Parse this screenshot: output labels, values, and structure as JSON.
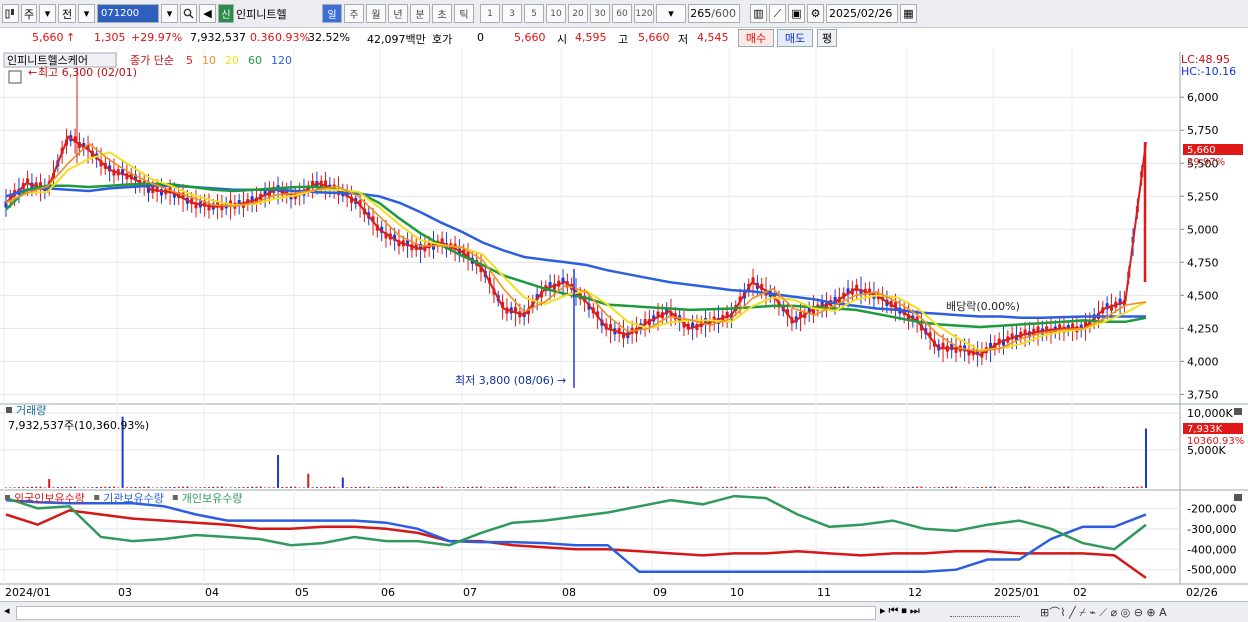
{
  "toolbar": {
    "chart_icon": "chart-icon",
    "period_main": "주",
    "prev_label": "전",
    "stock_code": "071200",
    "badge": "신",
    "stock_name": "인피니트헬",
    "periods": [
      "일",
      "주",
      "월",
      "년",
      "분",
      "초",
      "틱"
    ],
    "active_period": "일",
    "intervals": [
      "1",
      "3",
      "5",
      "10",
      "20",
      "30",
      "60",
      "120"
    ],
    "bar_count": "265",
    "bar_total": "/600",
    "date": "2025/02/26"
  },
  "quote": {
    "price": "5,660",
    "arrow": "↑",
    "change": "1,305",
    "change_pct": "+29.97%",
    "volume": "7,932,537",
    "vol_ratio": "0.36",
    "turnover": "0.93%",
    "ratio2": "32.52%",
    "amount": "42,097백만",
    "hoga_label": "호가",
    "hoga_value": "0",
    "hoga_price": "5,660",
    "open_label": "시",
    "open": "4,595",
    "high_label": "고",
    "high": "5,660",
    "low_label": "저",
    "low": "4,545",
    "buy_label": "매수",
    "sell_label": "매도",
    "avg_label": "평"
  },
  "price_panel": {
    "stock_label": "인피니트헬스케어",
    "ma_prefix": "종가 단순",
    "ma_periods": [
      "5",
      "10",
      "20",
      "60",
      "120"
    ],
    "ma_colors": [
      "#d42020",
      "#f09020",
      "#f0e020",
      "#1d9a3c",
      "#2b5fe0"
    ],
    "high_note": "최고 6,300 (02/01)",
    "low_note": "최저 3,800 (08/06)",
    "dividend_note": "배당락(0.00%)",
    "lc": "LC:48.95",
    "hc": "HC:-10.16",
    "last_price": "5,660",
    "last_pct": "29.97%"
  },
  "volume_panel": {
    "title": "거래량",
    "value": "7,932,537주(10,360.93%)",
    "last_k": "7,933K",
    "last_pct": "10360.93%"
  },
  "holdings_panel": {
    "series": [
      "외국인보유수량",
      "기관보유수량",
      "개인보유수량"
    ],
    "colors": [
      "#d41818",
      "#2b5fe0",
      "#2f9a5c"
    ]
  },
  "date_axis": {
    "labels": [
      "2024/01",
      "03",
      "04",
      "05",
      "06",
      "07",
      "08",
      "09",
      "10",
      "11",
      "12",
      "2025/01",
      "02"
    ],
    "right": "02/26"
  },
  "chart_data": [
    {
      "type": "line",
      "title": "인피니트헬스케어",
      "ylim": [
        3700,
        6350
      ],
      "y_ticks": [
        "6,000",
        "5,750",
        "5,500",
        "5,250",
        "5,000",
        "4,750",
        "4,500",
        "4,250",
        "4,000",
        "3,750"
      ],
      "series": [
        {
          "name": "종가",
          "color": "#d42020",
          "values": [
            5200,
            5350,
            5300,
            5700,
            5600,
            5450,
            5400,
            5300,
            5280,
            5200,
            5170,
            5180,
            5220,
            5300,
            5250,
            5350,
            5300,
            5200,
            5000,
            4900,
            4850,
            4900,
            4830,
            4700,
            4400,
            4350,
            4550,
            4600,
            4450,
            4250,
            4200,
            4300,
            4380,
            4250,
            4300,
            4350,
            4600,
            4500,
            4300,
            4400,
            4450,
            4550,
            4500,
            4400,
            4300,
            4100,
            4100,
            4050,
            4150,
            4200,
            4230,
            4250,
            4250,
            4400,
            4450,
            5660
          ]
        },
        {
          "name": "120",
          "color": "#2b5fe0",
          "values": [
            5250,
            5300,
            5310,
            5300,
            5290,
            5310,
            5320,
            5330,
            5330,
            5320,
            5310,
            5300,
            5300,
            5300,
            5290,
            5280,
            5275,
            5270,
            5250,
            5200,
            5130,
            5050,
            4980,
            4900,
            4840,
            4790,
            4770,
            4750,
            4730,
            4690,
            4660,
            4630,
            4600,
            4580,
            4560,
            4540,
            4530,
            4510,
            4490,
            4470,
            4440,
            4420,
            4400,
            4390,
            4370,
            4360,
            4350,
            4340,
            4340,
            4330,
            4330,
            4335,
            4340,
            4340,
            4340,
            4340
          ]
        },
        {
          "name": "60",
          "color": "#1d9a3c",
          "values": [
            5150,
            5300,
            5330,
            5330,
            5320,
            5330,
            5340,
            5345,
            5340,
            5320,
            5300,
            5290,
            5300,
            5310,
            5320,
            5320,
            5300,
            5280,
            5200,
            5080,
            4970,
            4880,
            4800,
            4730,
            4650,
            4600,
            4550,
            4510,
            4480,
            4430,
            4420,
            4410,
            4400,
            4390,
            4395,
            4400,
            4410,
            4420,
            4420,
            4410,
            4400,
            4390,
            4360,
            4330,
            4300,
            4280,
            4270,
            4260,
            4270,
            4280,
            4290,
            4300,
            4310,
            4300,
            4300,
            4330
          ]
        }
      ]
    },
    {
      "type": "bar",
      "title": "거래량",
      "unit": "K",
      "y_ticks": [
        "10,000K",
        "5,000K"
      ],
      "notable_values": [
        {
          "date": "2024/01",
          "value": 9500
        },
        {
          "date": "2024/02",
          "value": 4400
        },
        {
          "date": "2024/05",
          "value": 3900
        },
        {
          "date": "2025/02/26",
          "value": 7933
        }
      ]
    },
    {
      "type": "line",
      "title": "보유수량",
      "y_ticks": [
        "-200,000",
        "-300,000",
        "-400,000",
        "-500,000"
      ],
      "ylim": [
        -560000,
        -120000
      ],
      "series": [
        {
          "name": "외국인보유수량",
          "color": "#d41818",
          "values": [
            -230000,
            -280000,
            -210000,
            -230000,
            -250000,
            -260000,
            -270000,
            -280000,
            -300000,
            -300000,
            -290000,
            -290000,
            -300000,
            -320000,
            -360000,
            -360000,
            -380000,
            -390000,
            -400000,
            -400000,
            -410000,
            -420000,
            -430000,
            -420000,
            -420000,
            -410000,
            -420000,
            -430000,
            -420000,
            -420000,
            -410000,
            -410000,
            -420000,
            -420000,
            -420000,
            -430000,
            -540000
          ]
        },
        {
          "name": "기관보유수량",
          "color": "#2b5fe0",
          "values": [
            -160000,
            -170000,
            -175000,
            -175000,
            -175000,
            -190000,
            -230000,
            -260000,
            -260000,
            -260000,
            -260000,
            -260000,
            -270000,
            -300000,
            -360000,
            -365000,
            -365000,
            -370000,
            -380000,
            -380000,
            -510000,
            -510000,
            -510000,
            -510000,
            -510000,
            -510000,
            -510000,
            -510000,
            -510000,
            -510000,
            -500000,
            -450000,
            -450000,
            -350000,
            -290000,
            -290000,
            -230000
          ]
        },
        {
          "name": "개인보유수량",
          "color": "#2f9a5c",
          "values": [
            -150000,
            -200000,
            -190000,
            -340000,
            -360000,
            -350000,
            -330000,
            -340000,
            -350000,
            -380000,
            -370000,
            -340000,
            -360000,
            -360000,
            -380000,
            -320000,
            -270000,
            -260000,
            -240000,
            -220000,
            -190000,
            -160000,
            -180000,
            -140000,
            -150000,
            -230000,
            -290000,
            -280000,
            -260000,
            -300000,
            -310000,
            -280000,
            -260000,
            -300000,
            -370000,
            -400000,
            -280000
          ]
        }
      ]
    }
  ]
}
